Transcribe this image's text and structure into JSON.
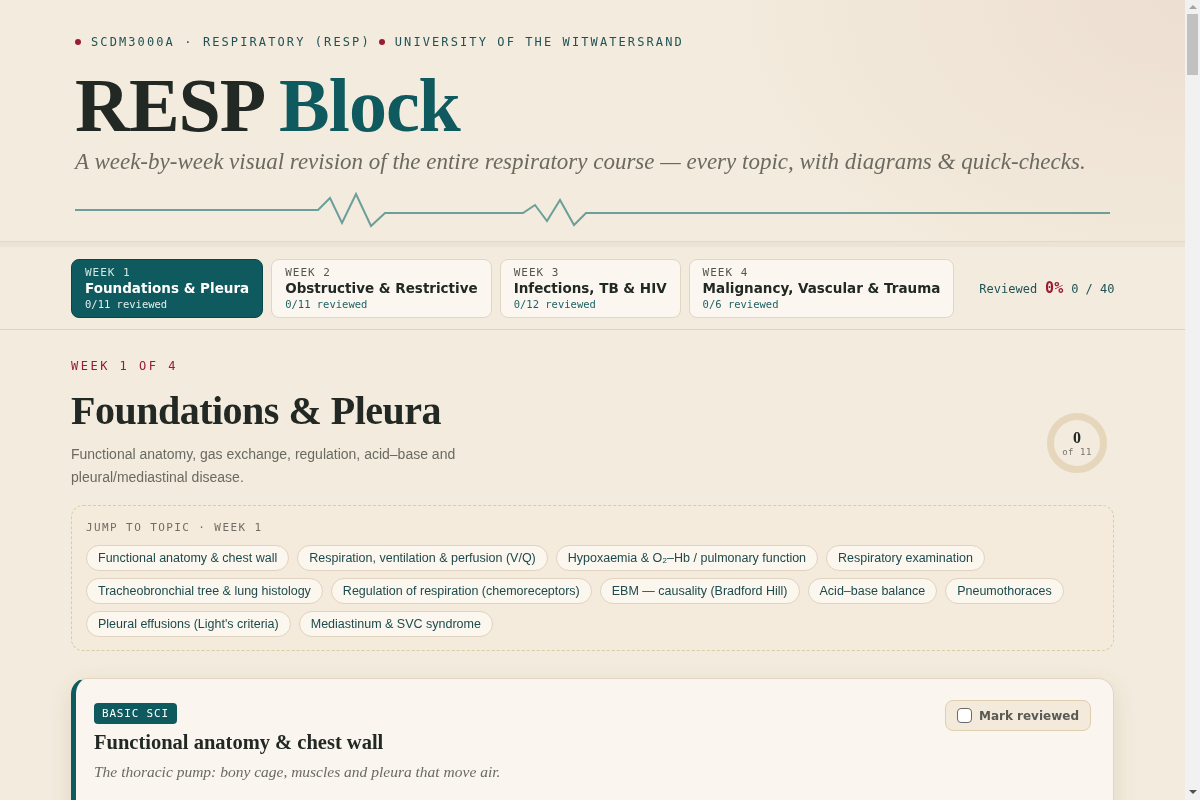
{
  "header": {
    "eyebrow": [
      {
        "text": "SCDM3000A · RESPIRATORY (RESP)"
      },
      {
        "text": "UNIVERSITY OF THE WITWATERSRAND"
      }
    ],
    "title": {
      "text": "RESP",
      "accent": "Block"
    },
    "subtitle": "A week-by-week visual revision of the entire respiratory course — every topic, with diagrams & quick-checks."
  },
  "weeks": [
    {
      "label": "WEEK 1",
      "title": "Foundations & Pleura",
      "progress": "0/11 reviewed",
      "selected": true
    },
    {
      "label": "WEEK 2",
      "title": "Obstructive & Restrictive",
      "progress": "0/11 reviewed",
      "selected": false
    },
    {
      "label": "WEEK 3",
      "title": "Infections, TB & HIV",
      "progress": "0/12 reviewed",
      "selected": false
    },
    {
      "label": "WEEK 4",
      "title": "Malignancy, Vascular & Trauma",
      "progress": "0/6 reviewed",
      "selected": false
    }
  ],
  "progress_summary": {
    "label": "Reviewed",
    "percent": "0%",
    "count": "0 / 40"
  },
  "week_section": {
    "eyebrow": "WEEK 1 OF 4",
    "title": "Foundations & Pleura",
    "description": "Functional anatomy, gas exchange, regulation, acid–base and pleural/mediastinal disease.",
    "ring": {
      "count": "0",
      "total": "of 11",
      "level": 0
    }
  },
  "jump": {
    "label": "JUMP TO TOPIC · WEEK 1",
    "topics": [
      "Functional anatomy & chest wall",
      "Respiration, ventilation & perfusion (V/Q)",
      "Hypoxaemia & O₂–Hb / pulmonary function",
      "Respiratory examination",
      "Tracheobronchial tree & lung histology",
      "Regulation of respiration (chemoreceptors)",
      "EBM — causality (Bradford Hill)",
      "Acid–base balance",
      "Pneumothoraces",
      "Pleural effusions (Light's criteria)",
      "Mediastinum & SVC syndrome"
    ]
  },
  "topic_cards": [
    {
      "tag": "BASIC SCI",
      "title": "Functional anatomy & chest wall",
      "summary": "The thoracic pump: bony cage, muscles and pleura that move air.",
      "button": "Mark reviewed",
      "reviewed": false
    }
  ]
}
